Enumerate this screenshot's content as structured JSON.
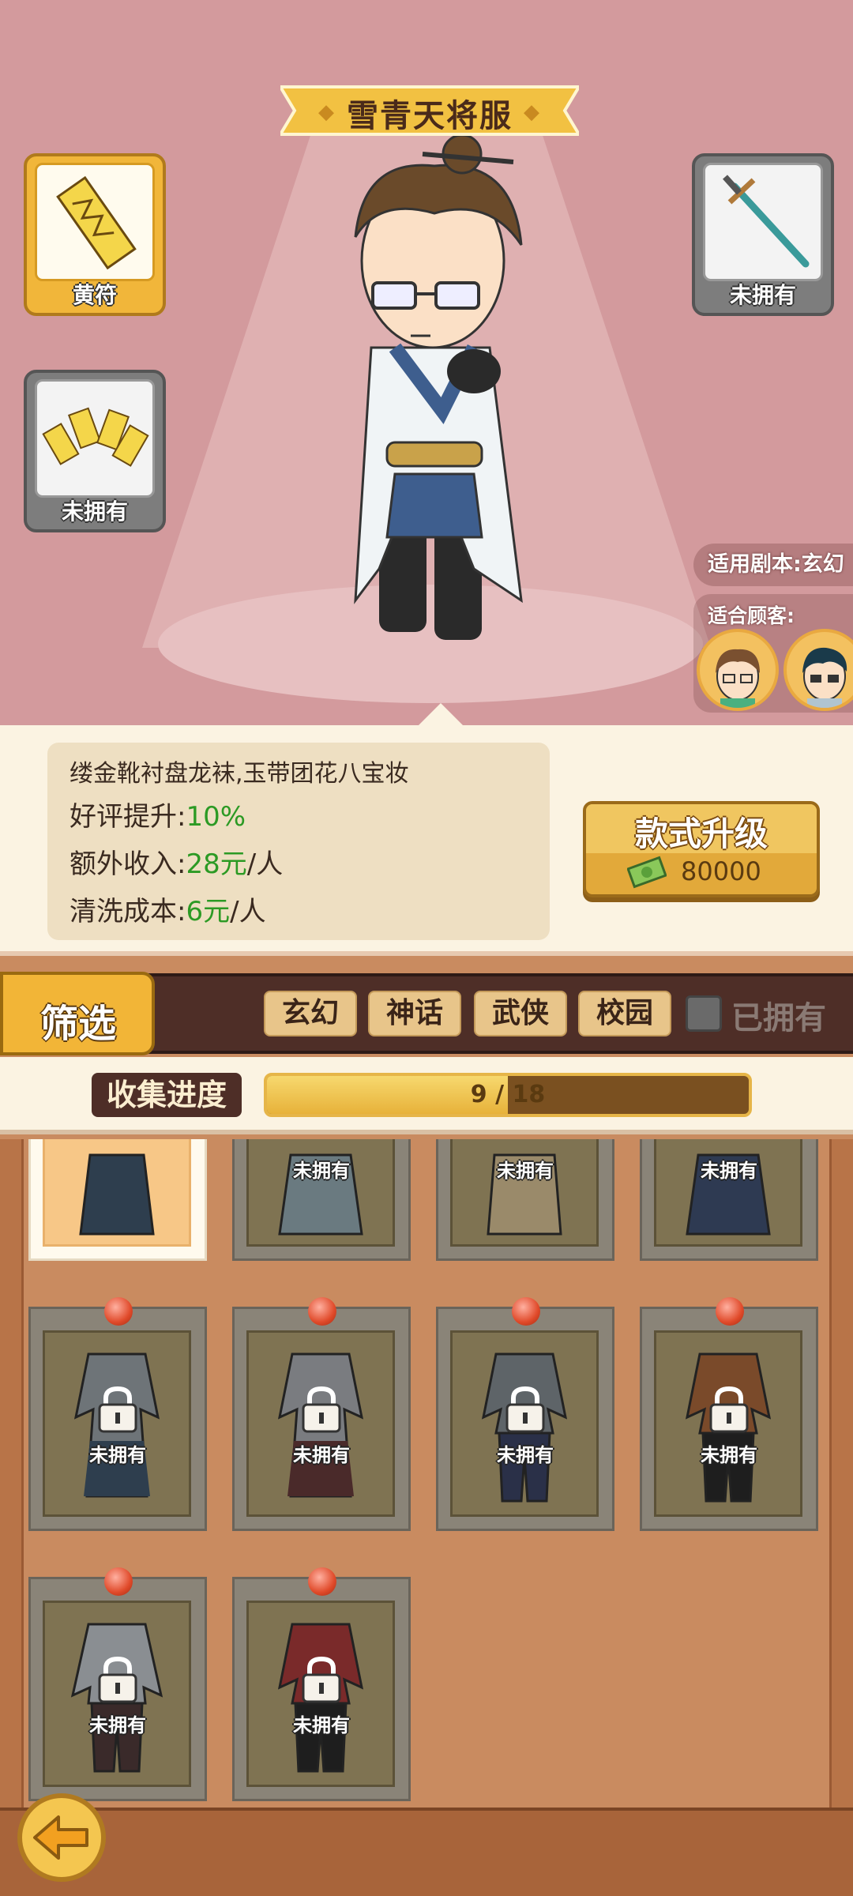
{
  "outfit": {
    "title": "雪青天将服",
    "description": "缕金靴衬盘龙袜,玉带团花八宝妆",
    "stats": [
      {
        "label": "好评提升:",
        "value": "10%",
        "suffix": ""
      },
      {
        "label": "额外收入:",
        "value": "28元",
        "suffix": "/人"
      },
      {
        "label": "清洗成本:",
        "value": "6元",
        "suffix": "/人"
      }
    ],
    "upgrade_label": "款式升级",
    "upgrade_cost": "80000"
  },
  "accessories": {
    "left_top": {
      "label": "黄符",
      "icon": "talisman-icon",
      "owned": true
    },
    "left_bottom": {
      "label": "未拥有",
      "icon": "talismans-icon",
      "owned": false
    },
    "right_top": {
      "label": "未拥有",
      "icon": "sword-icon",
      "owned": false
    }
  },
  "script_tag": "适用剧本:玄幻",
  "customers_label": "适合顾客:",
  "filter": {
    "button_label": "筛选",
    "tags": [
      "玄幻",
      "神话",
      "武侠",
      "校园"
    ],
    "owned_label": "已拥有"
  },
  "progress": {
    "label": "收集进度",
    "current": 9,
    "total": 18,
    "text": "9 / 18"
  },
  "wardrobe": {
    "row1": [
      {
        "label": "",
        "selected": true
      },
      {
        "label": "未拥有",
        "selected": false
      },
      {
        "label": "未拥有",
        "selected": false
      },
      {
        "label": "未拥有",
        "selected": false
      }
    ],
    "row2": [
      {
        "label": "未拥有"
      },
      {
        "label": "未拥有"
      },
      {
        "label": "未拥有"
      },
      {
        "label": "未拥有"
      }
    ],
    "row3": [
      {
        "label": "未拥有"
      },
      {
        "label": "未拥有"
      }
    ]
  },
  "colors": {
    "stage_bg": "#d39a9d",
    "accent_gold": "#f2b537",
    "value_green": "#2c9a24",
    "dark_brown": "#4e2e27"
  }
}
